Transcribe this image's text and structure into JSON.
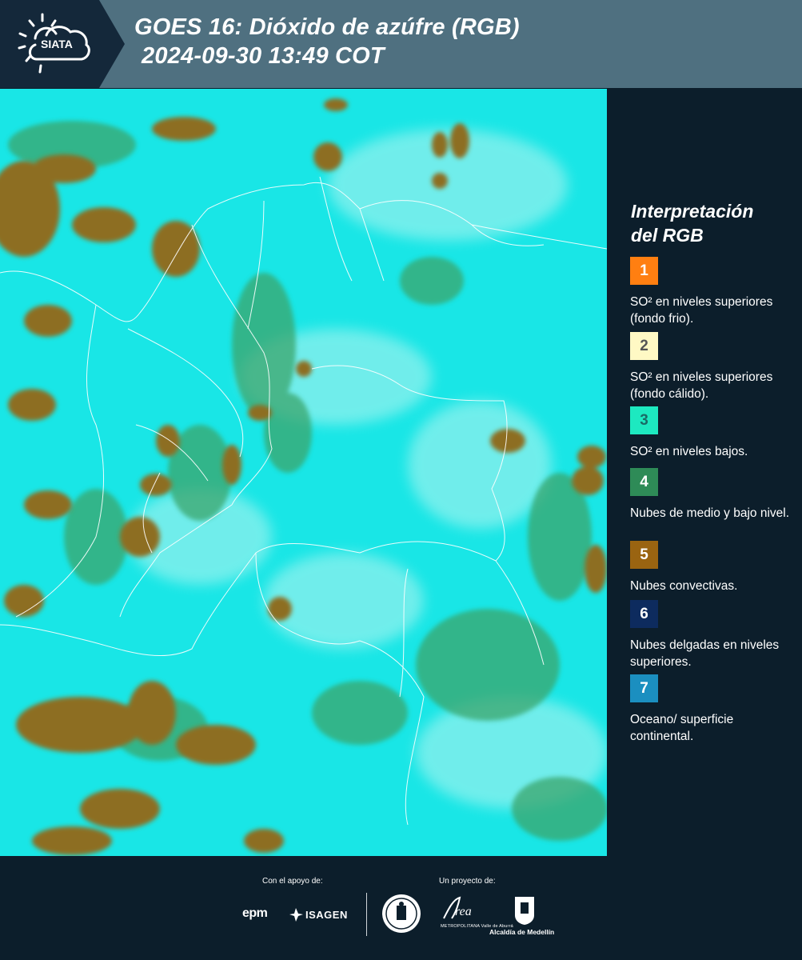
{
  "header": {
    "logo_text": "SIATA",
    "title_line1": "GOES 16: Dióxido de azúfre (RGB)",
    "title_line2": "2024-09-30 13:49 COT"
  },
  "map": {
    "base_color": "#19e8e8",
    "cloud_color": "#8d6e22",
    "mid_cloud_color": "#3aa06a",
    "border_color": "#ffffff"
  },
  "legend": {
    "title_line1": "Interpretación",
    "title_line2": "del RGB",
    "items": [
      {
        "number": "1",
        "color": "#ff7f11",
        "text_color": "#ffffff",
        "label": "SO² en niveles superiores (fondo frio)."
      },
      {
        "number": "2",
        "color": "#fff9c4",
        "text_color": "#555555",
        "label": "SO² en niveles superiores (fondo cálido)."
      },
      {
        "number": "3",
        "color": "#1de9c0",
        "text_color": "#1a6b66",
        "label": "SO² en niveles bajos."
      },
      {
        "number": "4",
        "color": "#2e8b57",
        "text_color": "#ffffff",
        "label": "Nubes de medio y bajo nivel."
      },
      {
        "number": "5",
        "color": "#9a6411",
        "text_color": "#ffffff",
        "label": "Nubes convectivas."
      },
      {
        "number": "6",
        "color": "#0d2b5e",
        "text_color": "#ffffff",
        "label": "Nubes delgadas en niveles superiores."
      },
      {
        "number": "7",
        "color": "#1b8fc0",
        "text_color": "#ffffff",
        "label": "Oceano/ superficie continental."
      }
    ]
  },
  "footer": {
    "support_label": "Con el apoyo de:",
    "project_label": "Un proyecto de:",
    "sponsor1": "epm",
    "sponsor2": "ISAGEN",
    "partner_area": "METROPOLITANA Valle de Aburrá",
    "partner_alcaldia": "Alcaldía de Medellín"
  }
}
